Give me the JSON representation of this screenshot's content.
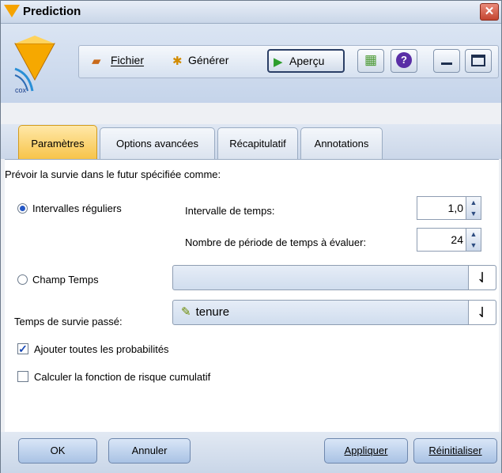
{
  "window": {
    "title": "Prediction",
    "node_icon_text": "cox"
  },
  "toolbar": {
    "fichier": "Fichier",
    "generer": "Générer",
    "apercu": "Aperçu"
  },
  "tabs": [
    {
      "label": "Paramètres",
      "active": true
    },
    {
      "label": "Options avancées",
      "active": false
    },
    {
      "label": "Récapitulatif",
      "active": false
    },
    {
      "label": "Annotations",
      "active": false
    }
  ],
  "settings": {
    "intro": "Prévoir la survie dans le futur spécifiée comme:",
    "radio_regular": "Intervalles réguliers",
    "interval_label": "Intervalle de temps:",
    "interval_value": "1,0",
    "periods_label": "Nombre de période de temps à évaluer:",
    "periods_value": "24",
    "radio_time_field": "Champ Temps",
    "time_field_value": "",
    "past_survival_label": "Temps de survie passé:",
    "past_survival_value": "tenure",
    "check_all_probs": "Ajouter toutes les probabilités",
    "check_all_probs_checked": true,
    "check_cumulative": "Calculer la fonction de risque cumulatif",
    "check_cumulative_checked": false
  },
  "footer": {
    "ok": "OK",
    "cancel": "Annuler",
    "apply": "Appliquer",
    "reset": "Réinitialiser"
  }
}
